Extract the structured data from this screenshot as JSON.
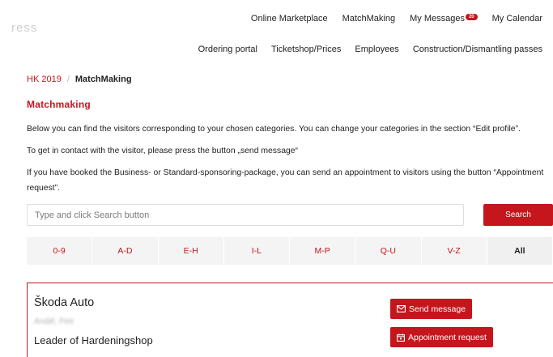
{
  "logo": {
    "text": "ress"
  },
  "nav_top": {
    "online_marketplace": "Online Marketplace",
    "matchmaking": "MatchMaking",
    "my_messages": "My Messages",
    "messages_count": "20",
    "my_calendar": "My Calendar"
  },
  "nav_secondary": {
    "ordering_portal": "Ordering portal",
    "ticketshop": "Ticketshop/Prices",
    "employees": "Employees",
    "construction": "Construction/Dismantling passes"
  },
  "breadcrumb": {
    "root": "HK 2019",
    "separator": "/",
    "current": "MatchMaking"
  },
  "page_title": "Matchmaking",
  "paragraphs": {
    "p1": "Below you can find the visitors corresponding to your chosen categories. You can change your categories in the section “Edit profile”.",
    "p2": "To get in contact with the visitor, please press the button „send message“",
    "p3": "If you have booked the Business- or Standard-sponsoring-package, you can send an appointment to visitors using the button “Appointment request”."
  },
  "search": {
    "placeholder": "Type and click Search button",
    "button_label": "Search"
  },
  "alpha_filter": [
    "0-9",
    "A-D",
    "E-H",
    "I-L",
    "M-P",
    "Q-U",
    "V-Z",
    "All"
  ],
  "result": {
    "company": "Škoda Auto",
    "contact_name": "Andiě, Petr",
    "role": "Leader of Hardeningshop",
    "send_message_label": "Send message",
    "appointment_label": "Appointment request"
  },
  "colors": {
    "accent": "#c4161c",
    "filter_bg": "#f4f4f4"
  }
}
